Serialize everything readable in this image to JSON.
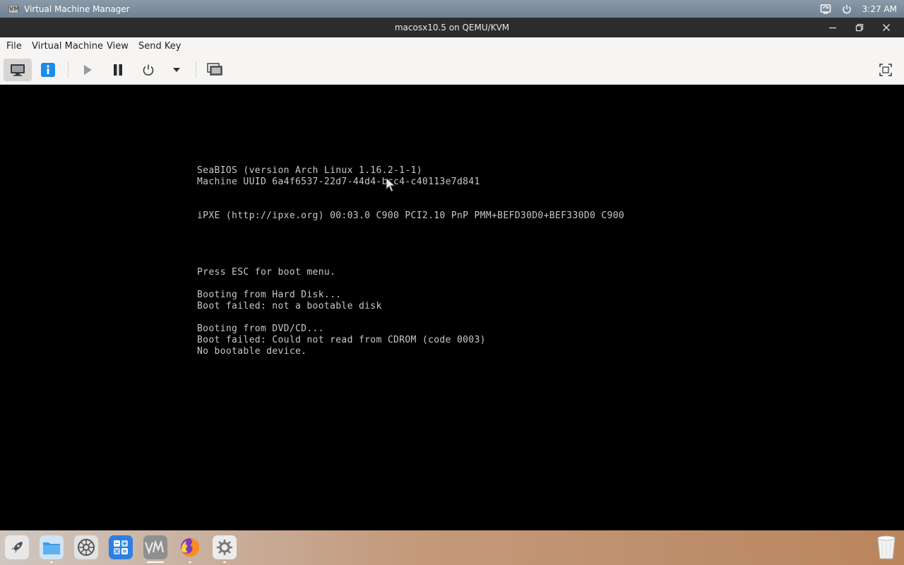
{
  "system_panel": {
    "app_name": "Virtual Machine Manager",
    "clock": "3:27 AM"
  },
  "window": {
    "title": "macosx10.5 on QEMU/KVM"
  },
  "menu": {
    "items": [
      "File",
      "Virtual Machine",
      "View",
      "Send Key"
    ]
  },
  "toolbar": {
    "buttons": [
      "console-view",
      "details-view",
      "run",
      "pause",
      "shutdown",
      "shutdown-menu",
      "snapshots",
      "fullscreen"
    ],
    "active": "console-view"
  },
  "console": {
    "lines": [
      "SeaBIOS (version Arch Linux 1.16.2-1-1)",
      "Machine UUID 6a4f6537-22d7-44d4-bcc4-c40113e7d841",
      "iPXE (http://ipxe.org) 00:03.0 C900 PCI2.10 PnP PMM+BEFD30D0+BEF330D0 C900",
      "Press ESC for boot menu.",
      "Booting from Hard Disk...",
      "Boot failed: not a bootable disk",
      "Booting from DVD/CD...",
      "Boot failed: Could not read from CDROM (code 0003)",
      "No bootable device."
    ]
  },
  "dock": {
    "apps": [
      "launchpad",
      "files",
      "system-settings",
      "calculator",
      "virt-manager",
      "firefox",
      "settings"
    ],
    "trash": "trash"
  },
  "colors": {
    "title_bar": "#2c2c2c",
    "console_bg": "#000000",
    "console_text": "#c8c8c8",
    "info_button": "#1c8ce8"
  }
}
